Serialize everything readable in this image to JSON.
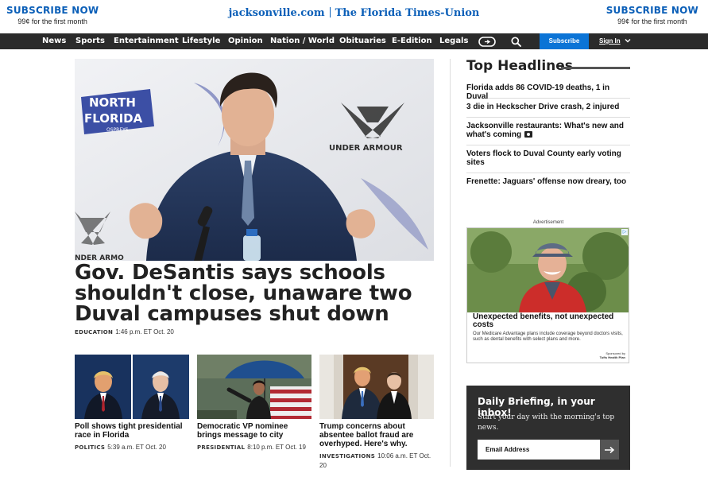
{
  "header": {
    "subscribe_left": {
      "cta": "SUBSCRIBE NOW",
      "price": "99¢ for the first month"
    },
    "subscribe_right": {
      "cta": "SUBSCRIBE NOW",
      "price": "99¢ for the first month"
    },
    "site_name": "jacksonville.com",
    "paper_name": "The Florida Times-Union"
  },
  "nav": {
    "items": [
      "News",
      "Sports",
      "Entertainment",
      "Lifestyle",
      "Opinion",
      "Nation / World",
      "Obituaries",
      "E-Edition",
      "Legals"
    ],
    "subscribe_label": "Subscribe",
    "signin_label": "Sign In",
    "icons": [
      "more-icon",
      "search-icon",
      "chevron-down-icon"
    ]
  },
  "hero": {
    "title": "Gov. DeSantis says schools shouldn't close, unaware two Duval campuses shut down",
    "category": "EDUCATION",
    "timestamp": "1:46 p.m. ET Oct. 20",
    "photo_text": {
      "banner_line1": "NORTH",
      "banner_line2": "FLORIDA",
      "banner_line3": "OSPREYS",
      "sponsor": "UNDER ARMOUR",
      "sponsor_cut": "NDER ARMO"
    }
  },
  "cards": [
    {
      "title": "Poll shows tight presidential race in Florida",
      "category": "POLITICS",
      "timestamp": "5:39 a.m. ET Oct. 20"
    },
    {
      "title": "Democratic VP nominee brings message to city",
      "category": "PRESIDENTIAL",
      "timestamp": "8:10 p.m. ET Oct. 19"
    },
    {
      "title": "Trump concerns about absentee ballot fraud are overhyped. Here's why.",
      "category": "INVESTIGATIONS",
      "timestamp": "10:06 a.m. ET Oct. 20"
    }
  ],
  "top_headlines": {
    "title": "Top Headlines",
    "items": [
      "Florida adds 86 COVID-19 deaths, 1 in Duval",
      "3 die in Heckscher Drive crash, 2 injured",
      "Jacksonville restaurants: What's new and what's coming",
      "Voters flock to Duval County early voting sites",
      "Frenette: Jaguars' offense now dreary, too"
    ]
  },
  "ad": {
    "label": "Advertisement",
    "headline": "Unexpected benefits, not unexpected costs",
    "body": "Our Medicare Advantage plans include coverage beyond doctors visits, such as dental benefits with select plans and more.",
    "sponsor_prefix": "Sponsored by",
    "sponsor_name": "Tufts Health Plan"
  },
  "newsletter": {
    "title": "Daily Briefing, in your inbox!",
    "description": "Start your day with the morning's top news.",
    "placeholder": "Email Address"
  },
  "colors": {
    "accent": "#0b5fb8",
    "nav_bg": "#2b2b2b",
    "subscribe_btn": "#0b74d6",
    "newsletter_bg": "#2f2f2f"
  }
}
